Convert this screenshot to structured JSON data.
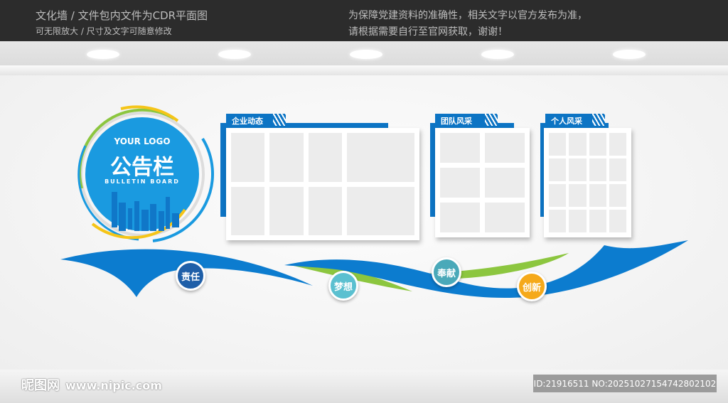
{
  "header": {
    "left_line1": "文化墙 / 文件包内文件为CDR平面图",
    "left_line2": "可无限放大 / 尺寸及文字可随意修改",
    "right_line1": "为保障党建资料的准确性，相关文字以官方发布为准，",
    "right_line2": "请根据需要自行至官网获取，谢谢！"
  },
  "logo": {
    "your_logo": "YOUR LOGO",
    "title": "公告栏",
    "subtitle": "BULLETIN BOARD",
    "color": "#1a9ae0"
  },
  "boards": [
    {
      "label": "企业动态",
      "rows": 2,
      "cols": 4
    },
    {
      "label": "团队风采",
      "rows": 3,
      "cols": 2
    },
    {
      "label": "个人风采",
      "rows": 4,
      "cols": 4
    }
  ],
  "values": [
    {
      "label": "责任",
      "color": "#1f5fa8"
    },
    {
      "label": "梦想",
      "color": "#5bc0d0"
    },
    {
      "label": "奉献",
      "color": "#4aa9b9"
    },
    {
      "label": "创新",
      "color": "#f5a91a"
    }
  ],
  "colors": {
    "primary_blue": "#0c7ccf",
    "accent_green": "#8cc63f",
    "accent_yellow": "#f5c518"
  },
  "watermark": {
    "brand": "昵图网",
    "url": "www.nipic.com",
    "id_text": "ID:21916511 NO:20251027154742802102"
  }
}
